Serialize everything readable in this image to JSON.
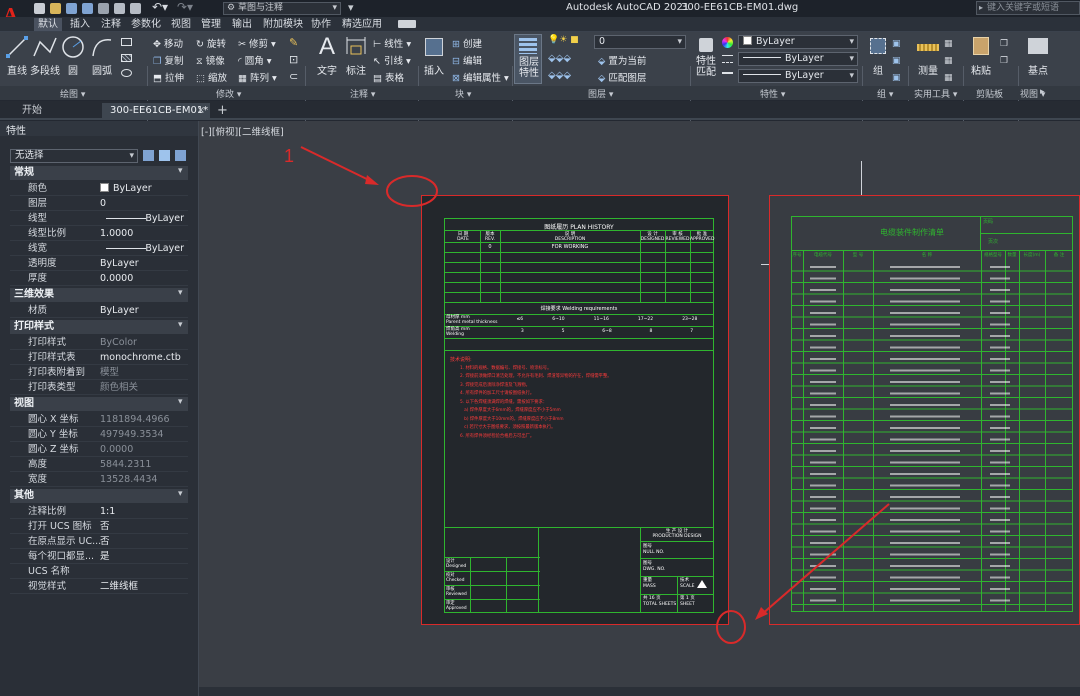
{
  "titlebar": {
    "app_title": "Autodesk AutoCAD 2021",
    "file_title": "300-EE61CB-EM01.dwg",
    "workspace": "草图与注释",
    "search_placeholder": "键入关键字或短语"
  },
  "menu": [
    "默认",
    "插入",
    "注释",
    "参数化",
    "视图",
    "管理",
    "输出",
    "附加模块",
    "协作",
    "精选应用"
  ],
  "ribbon": {
    "draw": {
      "line": "直线",
      "polyline": "多段线",
      "circle": "圆",
      "arc": "圆弧",
      "panel": "绘图"
    },
    "modify": {
      "move": "移动",
      "rotate": "旋转",
      "trim": "修剪",
      "copy": "复制",
      "mirror": "镜像",
      "fillet": "圆角",
      "stretch": "拉伸",
      "scale": "缩放",
      "array": "阵列",
      "panel": "修改"
    },
    "annotation": {
      "text": "文字",
      "dimension": "标注",
      "linear": "线性",
      "leader": "引线",
      "table": "表格",
      "panel": "注释"
    },
    "block": {
      "insert": "插入",
      "create": "创建",
      "edit": "编辑",
      "edit_attr": "编辑属性",
      "panel": "块"
    },
    "layers": {
      "layer_props": "图层\n特性",
      "current_layer": "0",
      "make_current": "置为当前",
      "match_layer": "匹配图层",
      "panel": "图层"
    },
    "properties": {
      "match": "特性\n匹配",
      "color": "ByLayer",
      "linetype": "ByLayer",
      "lineweight": "ByLayer",
      "panel": "特性"
    },
    "group": {
      "group": "组",
      "panel": "组"
    },
    "utilities": {
      "measure": "测量",
      "panel": "实用工具"
    },
    "clipboard": {
      "paste": "粘贴",
      "panel": "剪贴板"
    },
    "view": {
      "base": "基点",
      "panel": "视图"
    }
  },
  "doc_tabs": {
    "start": "开始",
    "file": "300-EE61CB-EM01*"
  },
  "properties_palette": {
    "title": "特性",
    "selection": "无选择",
    "sections": [
      {
        "name": "常规",
        "rows": [
          {
            "k": "颜色",
            "v": "ByLayer",
            "swatch": true
          },
          {
            "k": "图层",
            "v": "0"
          },
          {
            "k": "线型",
            "v": "ByLayer",
            "line": true
          },
          {
            "k": "线型比例",
            "v": "1.0000"
          },
          {
            "k": "线宽",
            "v": "ByLayer",
            "line": true
          },
          {
            "k": "透明度",
            "v": "ByLayer"
          },
          {
            "k": "厚度",
            "v": "0.0000"
          }
        ]
      },
      {
        "name": "三维效果",
        "rows": [
          {
            "k": "材质",
            "v": "ByLayer"
          }
        ]
      },
      {
        "name": "打印样式",
        "rows": [
          {
            "k": "打印样式",
            "v": "ByColor",
            "dim": true
          },
          {
            "k": "打印样式表",
            "v": "monochrome.ctb"
          },
          {
            "k": "打印表附着到",
            "v": "模型",
            "dim": true
          },
          {
            "k": "打印表类型",
            "v": "颜色相关",
            "dim": true
          }
        ]
      },
      {
        "name": "视图",
        "rows": [
          {
            "k": "圆心 X 坐标",
            "v": "1181894.4966",
            "dim": true
          },
          {
            "k": "圆心 Y 坐标",
            "v": "497949.3534",
            "dim": true
          },
          {
            "k": "圆心 Z 坐标",
            "v": "0.0000",
            "dim": true
          },
          {
            "k": "高度",
            "v": "5844.2311",
            "dim": true
          },
          {
            "k": "宽度",
            "v": "13528.4434",
            "dim": true
          }
        ]
      },
      {
        "name": "其他",
        "rows": [
          {
            "k": "注释比例",
            "v": "1:1"
          },
          {
            "k": "打开 UCS 图标",
            "v": "否"
          },
          {
            "k": "在原点显示 UC...",
            "v": "否"
          },
          {
            "k": "每个视口都显...",
            "v": "是"
          },
          {
            "k": "UCS 名称",
            "v": ""
          },
          {
            "k": "视觉样式",
            "v": "二维线框"
          }
        ]
      }
    ]
  },
  "viewport": {
    "label": "[-][俯视][二维线框]",
    "annotation_number": "1",
    "history": {
      "title": "图纸履历 PLAN HISTORY",
      "headers": [
        "日 期\nDATE",
        "版本\nREV.",
        "说 明\nDESCRIPTION",
        "设 计\nDESIGNED",
        "审 核\nREVIEWED",
        "批 准\nAPPROVED"
      ],
      "rev0": "0",
      "rev0_desc": "FOR WORKING"
    },
    "welding": {
      "title": "焊接要求 Welding requirements",
      "row1": "母材厚 mm\nParent metal thickness",
      "row2": "焊角高 mm\nWelding",
      "vals1": [
        "≤6",
        "6~10",
        "11~16",
        "17~22",
        "23~28"
      ],
      "vals2": [
        "3",
        "5",
        "6~8",
        "8",
        "7"
      ]
    },
    "notes": {
      "title": "技术说明:",
      "lines": [
        "1. 材料的规格、数据编号、焊接号、喷涂标号。",
        "2. 焊接前须做焊口清洁处理，不允许有毛刺、焊渣等异物的存在，焊缝需平整。",
        "3. 焊接完成后须除净焊渣及飞溅物。",
        "4. 所有焊件的加工尺寸请按图纸执行。",
        "5. 以下各焊缝须满焊的焊缝，需按如下要求：",
        "   a) 焊件厚度大于6mm的，焊缝厚度应不小于5mm",
        "   b) 焊件厚度大于10mm的，焊缝厚度应不小于8mm",
        "   c) 若尺寸大于图纸要求，须按照最新版本执行。",
        "6. 所有焊件须经检验合格后方可出厂。"
      ]
    },
    "titleblock": {
      "production": "生 产 设 计\nPRODUCTION DESIGN",
      "drawing_name": "图号\nNULL NO.",
      "drawing_no": "图号\nDWG. NO.",
      "mass": "重量\nMASS",
      "scale": "技术\nSCALE",
      "total": "共 16 页\nTOTAL SHEETS",
      "sheet": "第 1 页\nSHEET",
      "designed": "设计\nDesigned",
      "checked": "校对\nChecked",
      "reviewed": "审核\nReviewed",
      "approved": "审定\nApproved"
    },
    "cable_list": {
      "title": "电缆装件制作清单",
      "headers": [
        "序号",
        "电缆代号",
        "型 号",
        "名 称",
        "规格型号",
        "数量",
        "长度(m)",
        "备 注"
      ],
      "top_labels": [
        "页码",
        "页次"
      ]
    }
  },
  "colors": {
    "accent": "#ff3b3b",
    "sheet_green": "#2fb52f",
    "frame_red": "#d92a2a"
  }
}
